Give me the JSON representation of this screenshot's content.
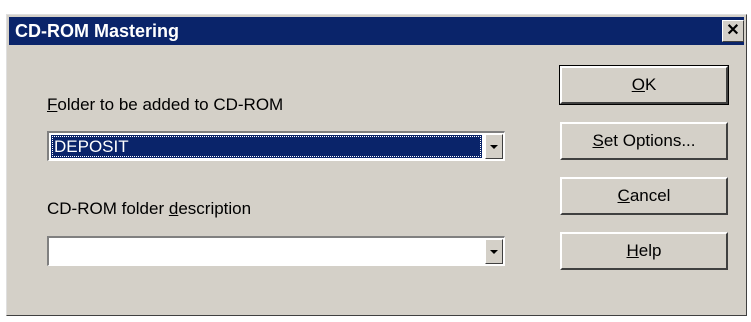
{
  "window": {
    "title": "CD-ROM Mastering",
    "close_glyph": "✕"
  },
  "fields": {
    "folder_label_prefix": "",
    "folder_label_mnemonic": "F",
    "folder_label_rest": "older to be added to CD-ROM",
    "folder_value": "DEPOSIT",
    "description_label_prefix": "CD-ROM folder ",
    "description_label_mnemonic": "d",
    "description_label_rest": "escription",
    "description_value": ""
  },
  "buttons": {
    "ok_mnemonic": "O",
    "ok_rest": "K",
    "set_options_mnemonic": "S",
    "set_options_rest": "et Options...",
    "cancel_mnemonic": "C",
    "cancel_rest": "ancel",
    "help_mnemonic": "H",
    "help_rest": "elp"
  },
  "colors": {
    "title_bar": "#0a246a",
    "dialog_face": "#d4d0c8",
    "selection": "#0a246a"
  },
  "icons": {
    "close": "close-icon",
    "dropdown": "chevron-down-icon"
  }
}
